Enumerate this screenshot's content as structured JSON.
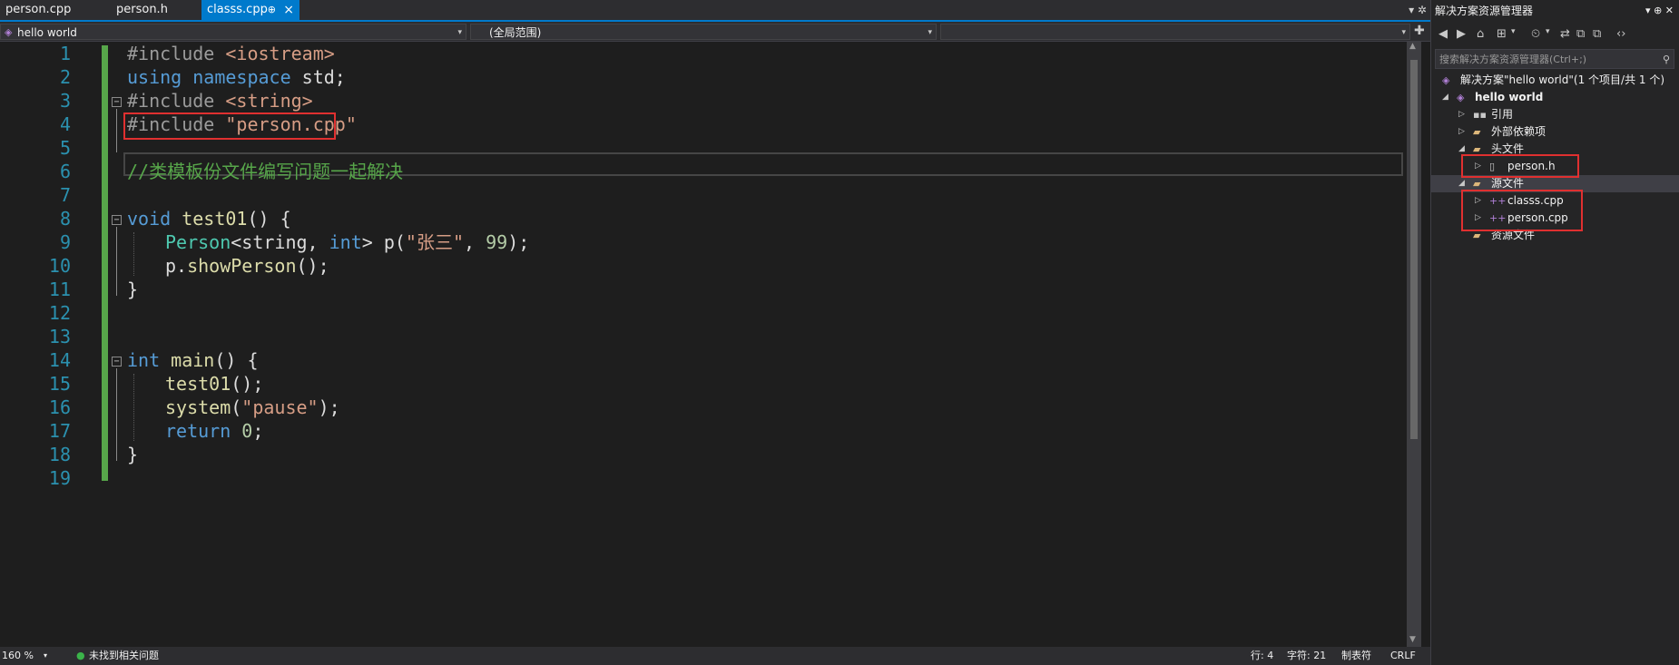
{
  "tabs": [
    {
      "label": "person.cpp",
      "active": false
    },
    {
      "label": "person.h",
      "active": false
    },
    {
      "label": "classs.cpp",
      "active": true
    }
  ],
  "tab_pin_glyph": "⊕",
  "tab_close_glyph": "×",
  "tab_tools": "▾ ✲",
  "nav": {
    "project": "hello world",
    "scope": "(全局范围)",
    "member": ""
  },
  "code_lines": [
    {
      "n": "1"
    },
    {
      "n": "2"
    },
    {
      "n": "3"
    },
    {
      "n": "4"
    },
    {
      "n": "5"
    },
    {
      "n": "6"
    },
    {
      "n": "7"
    },
    {
      "n": "8"
    },
    {
      "n": "9"
    },
    {
      "n": "10"
    },
    {
      "n": "11"
    },
    {
      "n": "12"
    },
    {
      "n": "13"
    },
    {
      "n": "14"
    },
    {
      "n": "15"
    },
    {
      "n": "16"
    },
    {
      "n": "17"
    },
    {
      "n": "18"
    },
    {
      "n": "19"
    }
  ],
  "code": {
    "l1": {
      "pp": "#include ",
      "str": "<iostream>"
    },
    "l2": {
      "kw1": "using",
      "kw2": "namespace",
      "rest": " std;"
    },
    "l3": {
      "pp": "#include ",
      "str": "<string>"
    },
    "l4": {
      "pp": "#include ",
      "str": "\"person.cpp\""
    },
    "l6": {
      "cm": "//类模板份文件编写问题一起解决"
    },
    "l8": {
      "kw": "void",
      "fn": "test01",
      "rest": "() {"
    },
    "l9": {
      "ty": "Person",
      "p1": "<string, ",
      "kw": "int",
      "p2": "> p(",
      "str": "\"张三\"",
      "p3": ", ",
      "num": "99",
      "p4": ");"
    },
    "l10": {
      "obj": "p.",
      "fn": "showPerson",
      "rest": "();"
    },
    "l11": {
      "rest": "}"
    },
    "l14": {
      "kw": "int",
      "fn": "main",
      "rest": "() {"
    },
    "l15": {
      "fn": "test01",
      "rest": "();"
    },
    "l16": {
      "fn": "system",
      "p1": "(",
      "str": "\"pause\"",
      "p2": ");"
    },
    "l17": {
      "kw": "return",
      "sp": " ",
      "num": "0",
      "rest": ";"
    },
    "l18": {
      "rest": "}"
    }
  },
  "status": {
    "zoom": "160 %",
    "issues": "未找到相关问题",
    "line": "行: 4",
    "col": "字符: 21",
    "tabs": "制表符",
    "eol": "CRLF"
  },
  "solution_explorer": {
    "title": "解决方案资源管理器",
    "title_tools": "▾ ⊕ ✕",
    "toolbar": [
      "◀",
      "▶",
      "⌂",
      "⊞",
      "▾",
      "⏲",
      "▾",
      "⇄",
      "⧉",
      "⧉",
      "‹›"
    ],
    "search_placeholder": "搜索解决方案资源管理器(Ctrl+;)",
    "search_glyph": "⚲",
    "nodes": [
      {
        "label": "解决方案\"hello world\"(1 个项目/共 1 个)"
      },
      {
        "label": "hello world"
      },
      {
        "label": "引用"
      },
      {
        "label": "外部依赖项"
      },
      {
        "label": "头文件"
      },
      {
        "label": "person.h"
      },
      {
        "label": "源文件"
      },
      {
        "label": "classs.cpp"
      },
      {
        "label": "person.cpp"
      },
      {
        "label": "资源文件"
      }
    ]
  },
  "colors": {
    "editor_bg": "#1e1e1e",
    "accent": "#007acc",
    "keyword": "#569cd6",
    "string": "#d69d85",
    "comment": "#57a64a",
    "type": "#4ec9b0",
    "highlight_box": "#e03030"
  }
}
